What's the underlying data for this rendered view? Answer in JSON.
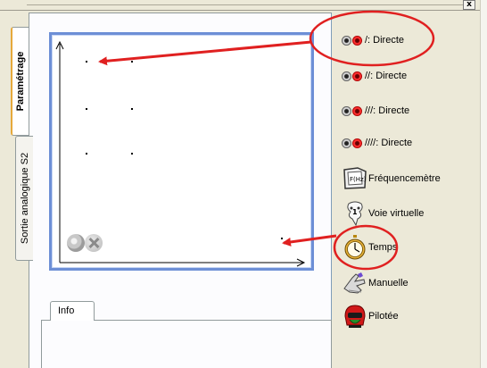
{
  "window": {
    "close_label": "x"
  },
  "tabs": [
    {
      "label": "Paramétrage",
      "active": true
    },
    {
      "label": "Sortie analogique S2",
      "active": false
    }
  ],
  "graph": {
    "ok_icon": "ok-circle-icon",
    "cancel_icon": "cancel-circle-icon"
  },
  "info_tab": {
    "label": "Info"
  },
  "list": {
    "items": [
      {
        "label": "/: Directe",
        "icon": "input-plug-icon"
      },
      {
        "label": "//: Directe",
        "icon": "input-plug-icon"
      },
      {
        "label": "///: Directe",
        "icon": "input-plug-icon"
      },
      {
        "label": "////: Directe",
        "icon": "input-plug-icon"
      },
      {
        "label": "Fréquencemètre",
        "icon": "frequency-meter-icon"
      },
      {
        "label": "Voie virtuelle",
        "icon": "virtual-channel-icon"
      },
      {
        "label": "Temps",
        "icon": "stopwatch-icon"
      },
      {
        "label": "Manuelle",
        "icon": "manual-hand-icon"
      },
      {
        "label": "Pilotée",
        "icon": "pilot-helmet-icon"
      }
    ]
  },
  "colors": {
    "annotation_red": "#e02020",
    "graph_border": "#6d8fd6",
    "background": "#ECE9D8"
  }
}
